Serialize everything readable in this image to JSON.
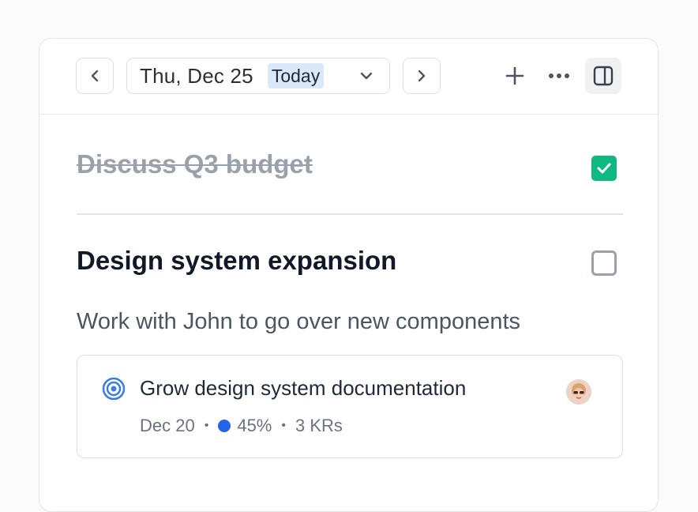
{
  "toolbar": {
    "prev_icon": "chevron-left-icon",
    "date_label": "Thu, Dec 25",
    "today_badge": "Today",
    "dropdown_icon": "chevron-down-icon",
    "next_icon": "chevron-right-icon",
    "add_icon": "plus-icon",
    "more_icon": "more-horizontal-icon",
    "panel_icon": "sidebar-toggle-icon"
  },
  "tasks": [
    {
      "title": "Discuss Q3 budget",
      "completed": true
    },
    {
      "title": "Design system expansion",
      "completed": false,
      "description": "Work with John to go over new components"
    }
  ],
  "goal": {
    "icon": "target-icon",
    "title": "Grow design system documentation",
    "date": "Dec 20",
    "progress": "45%",
    "krs": "3 KRs",
    "avatar": "avatar"
  },
  "colors": {
    "check_green": "#10b981",
    "progress_blue": "#2563eb",
    "today_badge_bg": "#dbe8fb",
    "target_blue": "#3b7be8"
  }
}
